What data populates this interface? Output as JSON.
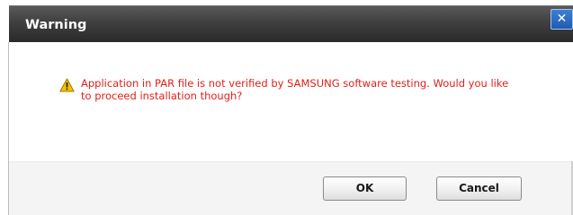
{
  "dialog": {
    "title": "Warning",
    "close_label": "✕",
    "message": "Application in PAR file is not verified by SAMSUNG software testing. Would you like to proceed installation though?",
    "icon": "warning-triangle-icon",
    "buttons": {
      "ok_label": "OK",
      "cancel_label": "Cancel"
    }
  },
  "colors": {
    "title_bar": "#3f3f3f",
    "message_text": "#e0201c",
    "close_button": "#1e5cb3",
    "warning_icon": "#f2c200"
  }
}
